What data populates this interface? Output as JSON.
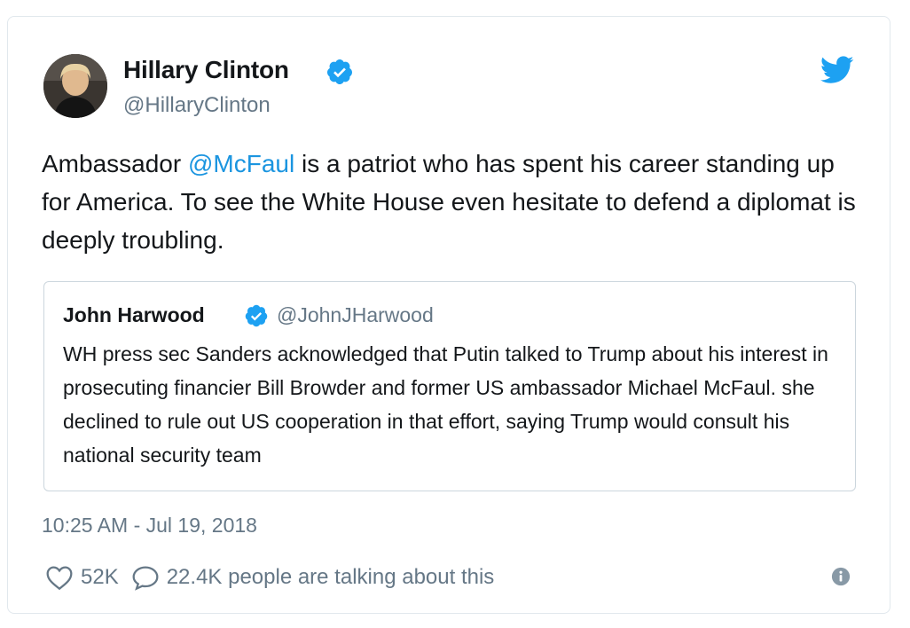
{
  "author": {
    "name": "Hillary Clinton",
    "handle": "@HillaryClinton"
  },
  "tweet": {
    "text_before": "Ambassador ",
    "mention": "@McFaul",
    "text_after": " is a patriot who has spent his career standing up for America. To see the White House even hesitate to defend a diplomat is deeply troubling."
  },
  "quote": {
    "name": "John Harwood",
    "handle": "@JohnJHarwood",
    "text": "WH press sec Sanders acknowledged that Putin talked to Trump about his interest in prosecuting financier Bill Browder and former US ambassador Michael McFaul. she declined to rule out US cooperation in that effort, saying Trump would consult his national security team"
  },
  "timestamp": "10:25 AM - Jul 19, 2018",
  "actions": {
    "likes": "52K",
    "conversation": "22.4K people are talking about this"
  },
  "icons": {
    "verified": "verified-badge-icon",
    "logo": "twitter-bird-icon",
    "like": "heart-icon",
    "reply": "speech-bubble-icon",
    "info": "info-icon"
  },
  "colors": {
    "accent": "#1da1f2",
    "link": "#1b95e0",
    "muted": "#657786",
    "border": "#e1e8ed"
  }
}
